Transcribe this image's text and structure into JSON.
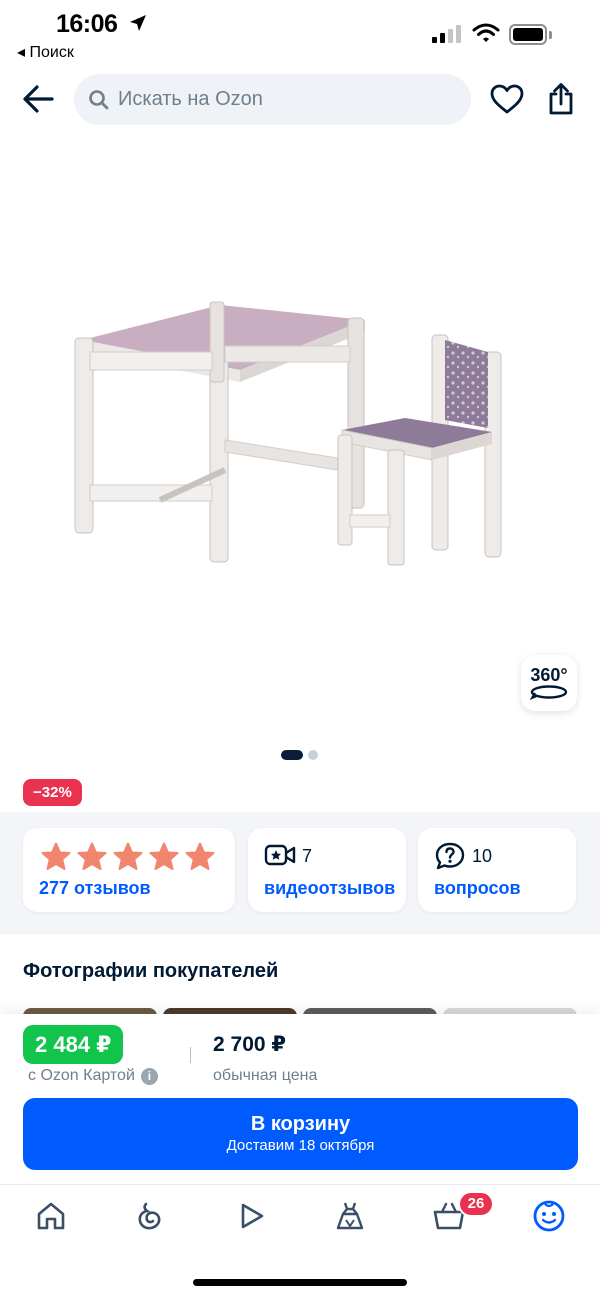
{
  "status_bar": {
    "time": "16:06",
    "back_app": "◂ Поиск"
  },
  "header": {
    "search_placeholder": "Искать на Ozon"
  },
  "gallery": {
    "badge_360": "360°",
    "slides_total": 2,
    "slide_active": 1
  },
  "discount_badge": "−32%",
  "cards": {
    "rating": {
      "stars": 5,
      "link": "277 отзывов"
    },
    "video": {
      "count": "7",
      "link": "видеоотзывов"
    },
    "questions": {
      "count": "10",
      "link": "вопросов"
    }
  },
  "photos_section": {
    "title": "Фотографии покупателей"
  },
  "price": {
    "card_price": "2 484 ₽",
    "card_label": "с Ozon Картой",
    "regular_price": "2 700 ₽",
    "regular_label": "обычная цена"
  },
  "cart_button": {
    "label": "В корзину",
    "delivery": "Доставим 18 октября"
  },
  "tabbar": {
    "items": [
      {
        "name": "home",
        "icon": "home-icon"
      },
      {
        "name": "fresh",
        "icon": "swirl-icon"
      },
      {
        "name": "video",
        "icon": "play-icon"
      },
      {
        "name": "fashion",
        "icon": "dress-icon"
      },
      {
        "name": "cart",
        "icon": "basket-icon"
      },
      {
        "name": "profile",
        "icon": "smile-icon"
      }
    ],
    "cart_count": "26"
  },
  "colors": {
    "accent": "#005bff",
    "green": "#10c44c",
    "discount": "#e8324f",
    "star": "#f0866d",
    "text": "#001a34"
  }
}
